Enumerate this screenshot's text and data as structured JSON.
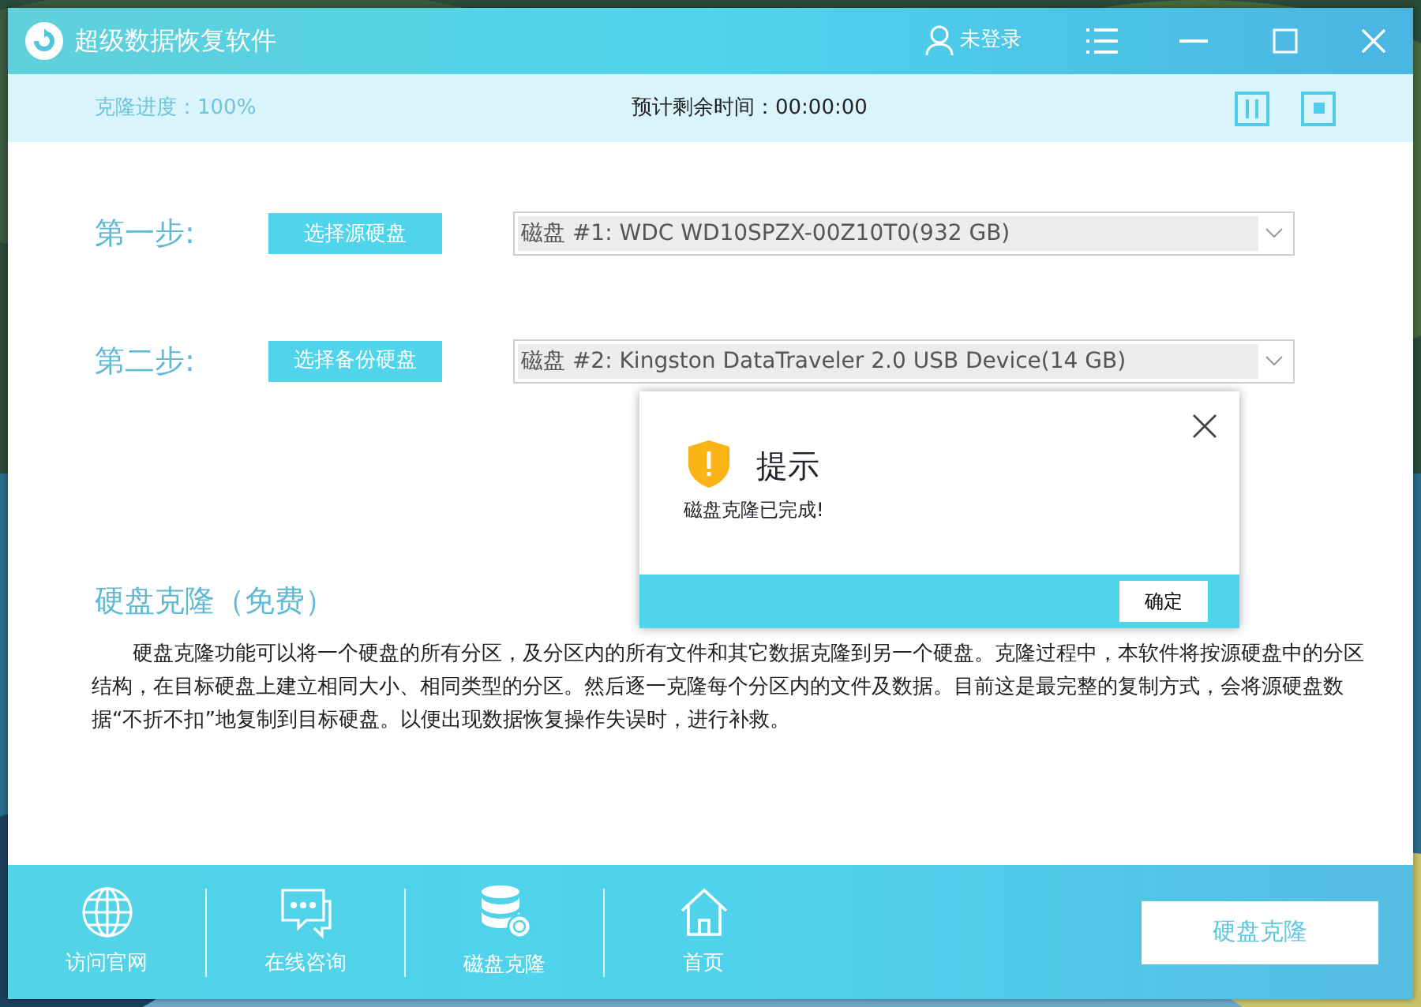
{
  "window": {
    "title": "超级数据恢复软件",
    "user": "未登录"
  },
  "progress_bar": {
    "progress": "克隆进度：100%",
    "level": 1,
    "remaining": "预计剩余时间：00:00:00"
  },
  "steps": [
    {
      "label": "第一步:",
      "button": "选择源硬盘",
      "disk": "磁盘 #1: WDC WD10SPZX-00Z10T0(932 GB)"
    },
    {
      "label": "第二步:",
      "button": "选择备份硬盘",
      "disk": "磁盘 #2: Kingston DataTraveler 2.0 USB Device(14 GB)"
    }
  ],
  "section": {
    "title": "硬盘克隆（免费）",
    "paragraph": "硬盘克隆功能可以将一个硬盘的所有分区，及分区内的所有文件和其它数据克隆到另一个硬盘。克隆过程中，本软件将按源硬盘中的分区结构，在目标硬盘上建立相同大小、相同类型的分区。然后逐一克隆每个分区内的文件及数据。目前这是最完整的复制方式，会将源硬盘数据“不折不扣”地复制到目标硬盘。以便出现数据恢复操作失误时，进行补救。"
  },
  "dialog": {
    "title": "提示",
    "message": "磁盘克隆已完成!",
    "button": "确定"
  },
  "bottom_nav": [
    {
      "kind": "globe",
      "label": "访问官网"
    },
    {
      "kind": "chat",
      "label": "在线咨询"
    },
    {
      "kind": "database",
      "label": "磁盘克隆"
    },
    {
      "kind": "home",
      "label": "首页"
    }
  ],
  "action_button": "硬盘克隆"
}
